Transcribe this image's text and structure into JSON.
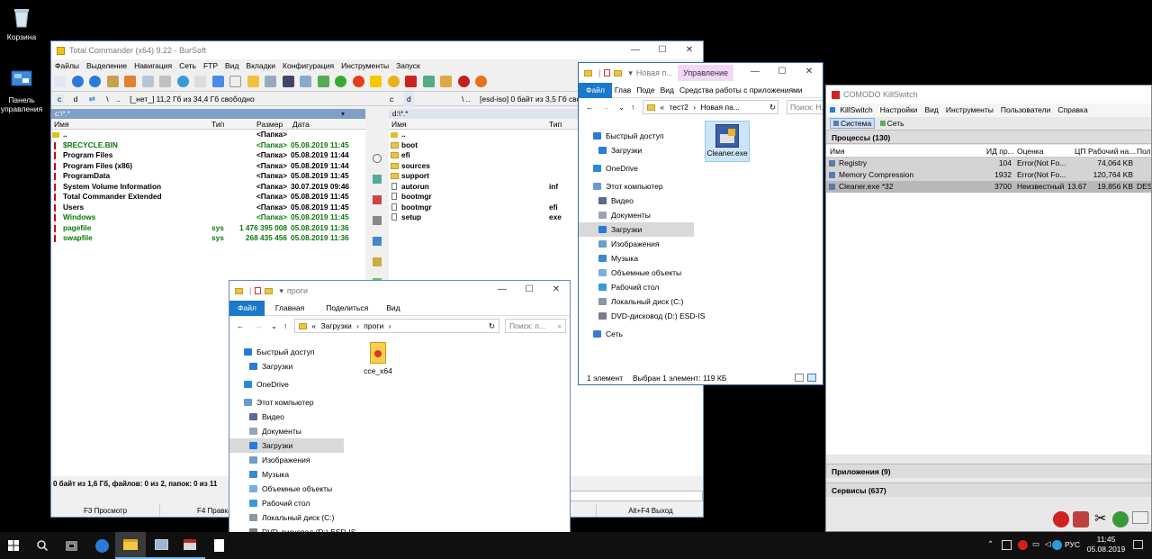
{
  "desktop": {
    "icons": [
      {
        "label": "Корзина",
        "icon": "recycle-bin-icon"
      },
      {
        "label": "Панель управления",
        "icon": "control-panel-icon"
      }
    ]
  },
  "tc": {
    "title": "Total Commander (x64) 9.22 - BurSoft",
    "menu": [
      "Файлы",
      "Выделение",
      "Навигация",
      "Сеть",
      "FTP",
      "Вид",
      "Вкладки",
      "Конфигурация",
      "Инструменты",
      "Запуск"
    ],
    "left_drive": "c",
    "left_drive2": "d",
    "left_drive_info": "[_нет_]  11,2 Гб из 34,4 Гб свободно",
    "right_drive_info": "[esd-iso]  0 байт из 3,5 Гб свободно",
    "left_path": "c:\\*.*",
    "right_path": "d:\\*.*",
    "cols": {
      "name": "Имя",
      "type": "Тип",
      "size": "Размер",
      "date": "Дата"
    },
    "left_files": [
      {
        "name": "..",
        "type": "",
        "size": "<Папка>",
        "date": "",
        "color": "#000"
      },
      {
        "name": "$RECYCLE.BIN",
        "type": "",
        "size": "<Папка>",
        "date": "05.08.2019 11:45",
        "color": "#0a7a0a"
      },
      {
        "name": "Program Files",
        "type": "",
        "size": "<Папка>",
        "date": "05.08.2019 11:44",
        "color": "#000"
      },
      {
        "name": "Program Files (x86)",
        "type": "",
        "size": "<Папка>",
        "date": "05.08.2019 11:44",
        "color": "#000"
      },
      {
        "name": "ProgramData",
        "type": "",
        "size": "<Папка>",
        "date": "05.08.2019 11:45",
        "color": "#000"
      },
      {
        "name": "System Volume Information",
        "type": "",
        "size": "<Папка>",
        "date": "30.07.2019 09:46",
        "color": "#000"
      },
      {
        "name": "Total Commander Extended",
        "type": "",
        "size": "<Папка>",
        "date": "05.08.2019 11:45",
        "color": "#000"
      },
      {
        "name": "Users",
        "type": "",
        "size": "<Папка>",
        "date": "05.08.2019 11:45",
        "color": "#000"
      },
      {
        "name": "Windows",
        "type": "",
        "size": "<Папка>",
        "date": "05.08.2019 11:45",
        "color": "#0a7a0a"
      },
      {
        "name": "pagefile",
        "type": "sys",
        "size": "1 476 395 008",
        "date": "05.08.2019 11:36",
        "color": "#0a7a0a"
      },
      {
        "name": "swapfile",
        "type": "sys",
        "size": "268 435 456",
        "date": "05.08.2019 11:36",
        "color": "#0a7a0a"
      }
    ],
    "right_files": [
      {
        "name": "..",
        "type": ""
      },
      {
        "name": "boot",
        "type": ""
      },
      {
        "name": "efi",
        "type": ""
      },
      {
        "name": "sources",
        "type": ""
      },
      {
        "name": "support",
        "type": ""
      },
      {
        "name": "autorun",
        "type": "inf"
      },
      {
        "name": "bootmgr",
        "type": ""
      },
      {
        "name": "bootmgr",
        "type": "efi"
      },
      {
        "name": "setup",
        "type": "exe"
      }
    ],
    "status_left": "0 байт из 1,6 Гб, файлов: 0 из 2, папок: 0 из 11",
    "fkeys": [
      "F3 Просмотр",
      "F4 Правка",
      "",
      "",
      "",
      "Alt+F4 Выход"
    ]
  },
  "ex1": {
    "title": "Новая п...",
    "manage": "Управление",
    "tabs": [
      "Файл",
      "Глав",
      "Поде",
      "Вид",
      "Средства работы с приложениями"
    ],
    "crumb": [
      "«",
      "тест2",
      "›",
      "Новая па..."
    ],
    "search": "Поиск: Н...",
    "nav": [
      "Быстрый доступ",
      "Загрузки",
      "OneDrive",
      "Этот компьютер",
      "Видео",
      "Документы",
      "Загрузки",
      "Изображения",
      "Музыка",
      "Объемные объекты",
      "Рабочий стол",
      "Локальный диск (C:)",
      "DVD-дисковод (D:) ESD-IS",
      "Сеть"
    ],
    "file": "Cleaner.exe",
    "status_count": "1 элемент",
    "status_sel": "Выбран 1 элемент: 119 КБ"
  },
  "ex2": {
    "title": "проги",
    "tabs": [
      "Файл",
      "Главная",
      "Поделиться",
      "Вид"
    ],
    "crumb": [
      "«",
      "Загрузки",
      "›",
      "проги",
      "›"
    ],
    "search": "Поиск: п...",
    "nav": [
      "Быстрый доступ",
      "Загрузки",
      "OneDrive",
      "Этот компьютер",
      "Видео",
      "Документы",
      "Загрузки",
      "Изображения",
      "Музыка",
      "Объемные объекты",
      "Рабочий стол",
      "Локальный диск (C:)",
      "DVD-дисковод (D:) ESD-IS"
    ],
    "file": "cce_x64"
  },
  "ks": {
    "title": "COMODO KillSwitch",
    "menu": [
      "KillSwitch",
      "Настройки",
      "Вид",
      "Инструменты",
      "Пользователи",
      "Справка"
    ],
    "tabs": [
      "Система",
      "Сеть"
    ],
    "processes": "Процессы (130)",
    "cols": [
      "Имя",
      "ИД пр...",
      "Оценка",
      "ЦП",
      "Рабочий на...",
      "Поль"
    ],
    "rows": [
      {
        "name": "Registry",
        "pid": "104",
        "rating": "Error(Not Fo...",
        "cpu": "",
        "mem": "74,064 KB",
        "user": ""
      },
      {
        "name": "Memory Compression",
        "pid": "1932",
        "rating": "Error(Not Fo...",
        "cpu": "",
        "mem": "120,764 KB",
        "user": ""
      },
      {
        "name": "Cleaner.exe *32",
        "pid": "3700",
        "rating": "Неизвестный",
        "cpu": "13.67",
        "mem": "19,856 KB",
        "user": "DESKT"
      }
    ],
    "apps": "Приложения (9)",
    "services": "Сервисы (637)"
  },
  "taskbar": {
    "lang": "РУС",
    "time": "11:45",
    "date": "05.08.2019"
  }
}
